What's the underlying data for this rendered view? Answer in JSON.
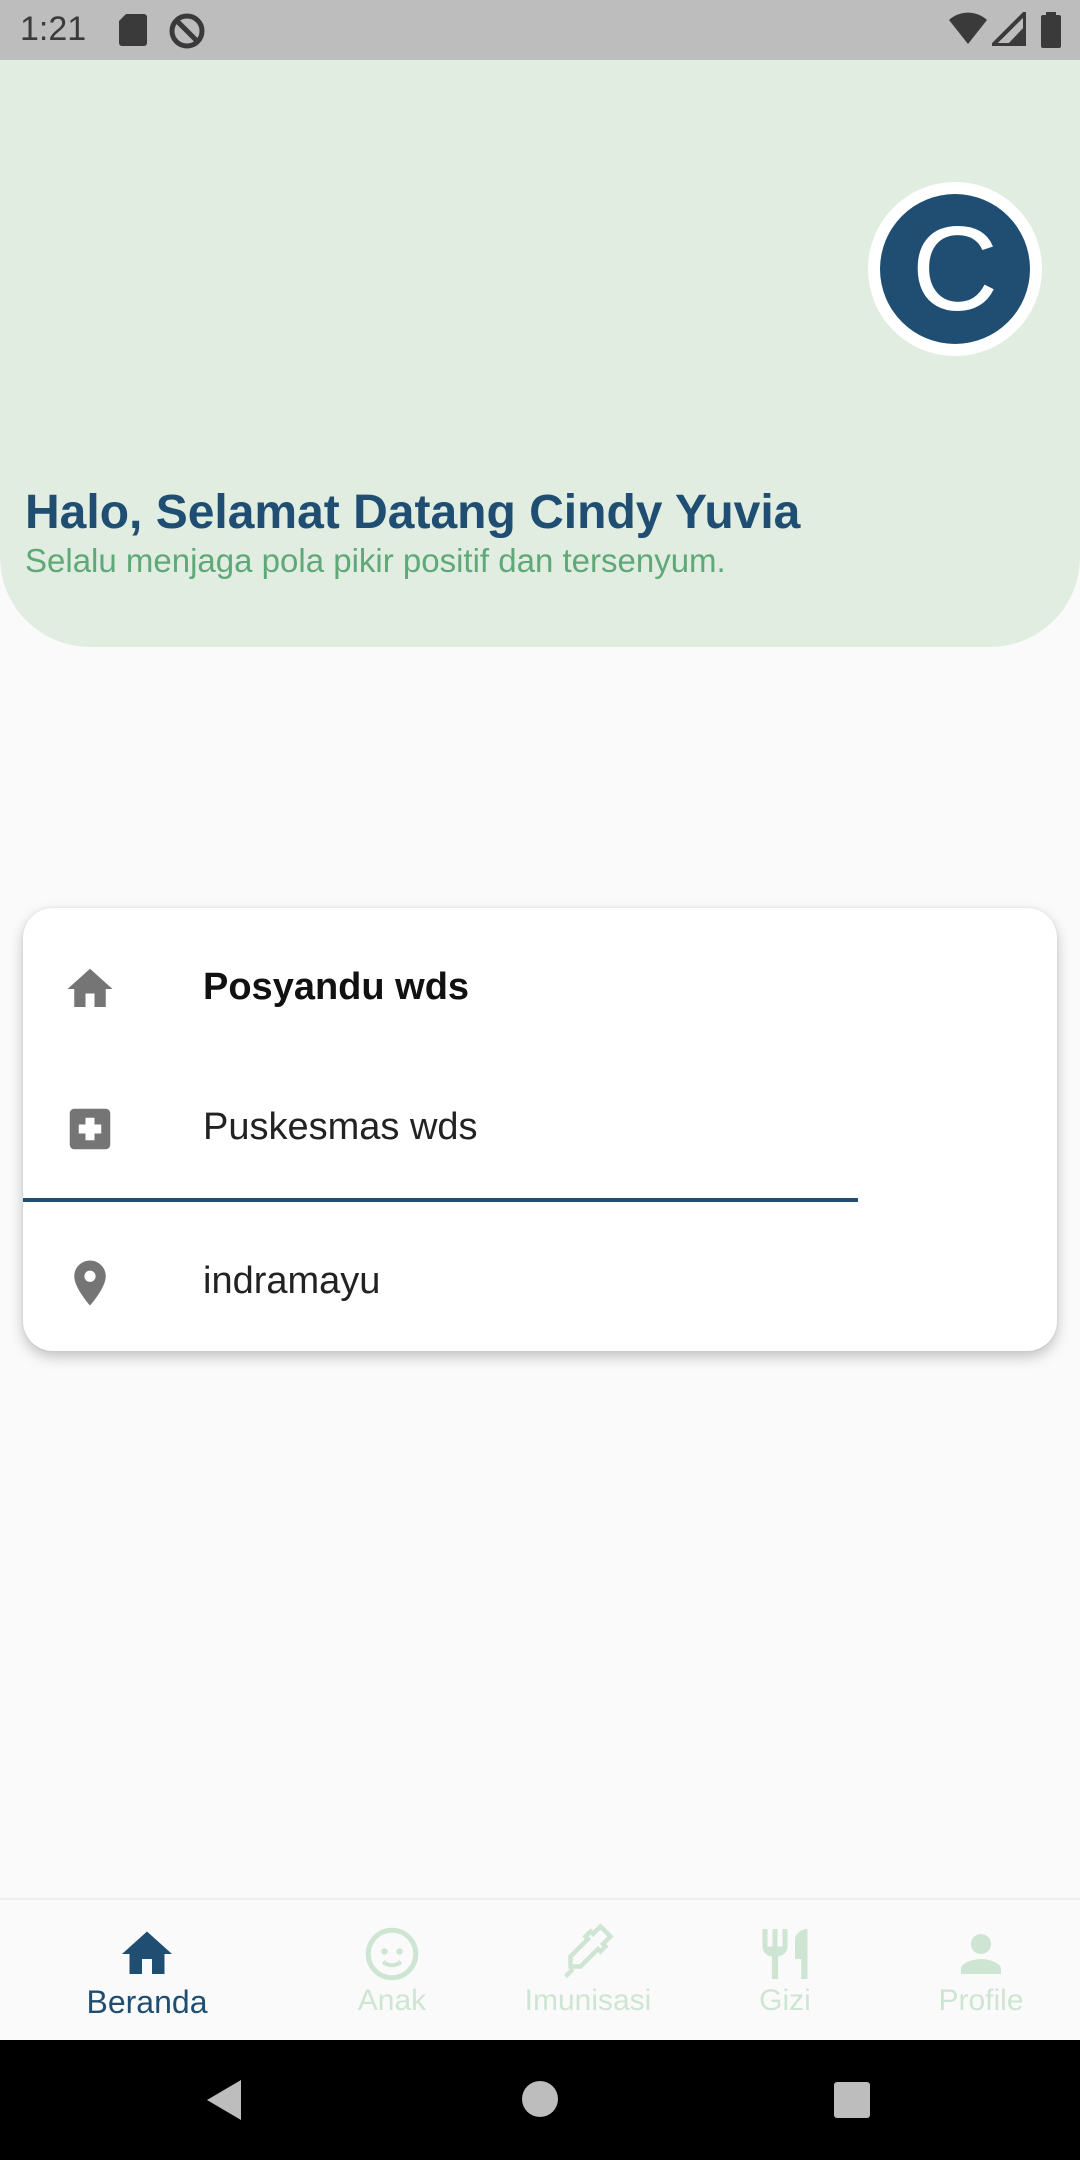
{
  "status_bar": {
    "time": "1:21",
    "icons": [
      "sd-card-icon",
      "do-not-disturb-icon",
      "wifi-icon",
      "signal-icon",
      "battery-icon"
    ]
  },
  "header": {
    "avatar_letter": "C",
    "greeting": "Halo, Selamat Datang Cindy Yuvia",
    "subtitle": "Selalu menjaga pola pikir positif dan tersenyum."
  },
  "card": {
    "items": [
      {
        "icon": "home-icon",
        "label": "Posyandu wds"
      },
      {
        "icon": "medical-cross-icon",
        "label": "Puskesmas wds"
      },
      {
        "icon": "location-pin-icon",
        "label": "indramayu"
      }
    ]
  },
  "bottom_nav": {
    "items": [
      {
        "icon": "home-icon",
        "label": "Beranda",
        "active": true
      },
      {
        "icon": "baby-face-icon",
        "label": "Anak",
        "active": false
      },
      {
        "icon": "syringe-icon",
        "label": "Imunisasi",
        "active": false
      },
      {
        "icon": "utensils-icon",
        "label": "Gizi",
        "active": false
      },
      {
        "icon": "person-icon",
        "label": "Profile",
        "active": false
      }
    ]
  },
  "colors": {
    "primary": "#1f4e72",
    "header_bg": "#e0ede0",
    "subtitle": "#5fa878",
    "inactive_nav": "#cfe5d4"
  }
}
